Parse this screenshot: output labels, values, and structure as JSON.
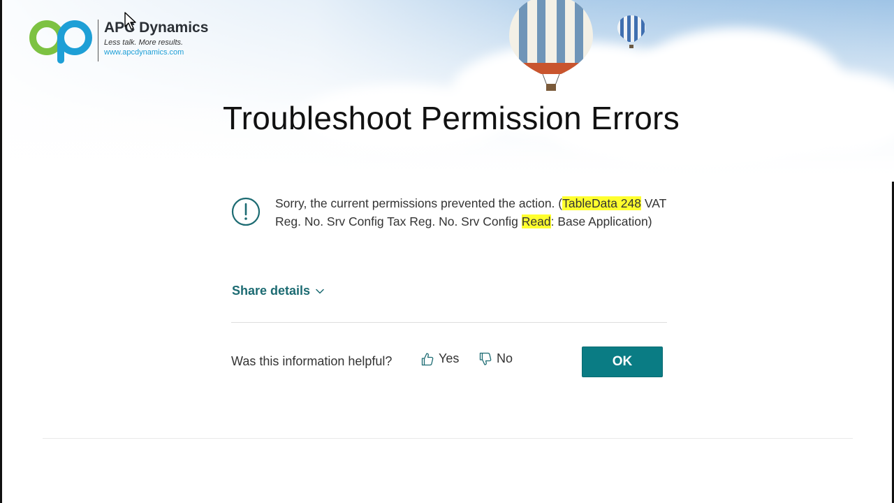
{
  "logo": {
    "brand": "APC Dynamics",
    "tagline": "Less talk. More results.",
    "url": "www.apcdynamics.com"
  },
  "slide": {
    "title": "Troubleshoot Permission Errors"
  },
  "dialog": {
    "message_parts": [
      {
        "text": "Sorry, the current permissions prevented the action. (",
        "highlight": false
      },
      {
        "text": "TableData 248",
        "highlight": true
      },
      {
        "text": " VAT Reg. No. Srv Config Tax Reg. No. Srv Config ",
        "highlight": false
      },
      {
        "text": "Read",
        "highlight": true
      },
      {
        "text": ": Base Application)",
        "highlight": false
      }
    ],
    "share_details_label": "Share details",
    "feedback_question": "Was this information helpful?",
    "yes_label": "Yes",
    "no_label": "No",
    "ok_label": "OK"
  },
  "colors": {
    "accent": "#0a7c84",
    "link": "#1c6b72",
    "highlight": "#ffff2e",
    "logo_green": "#7dc242",
    "logo_blue": "#1e9fd6"
  },
  "icons": {
    "info": "info-circle-icon",
    "share_chevron": "chevron-down-icon",
    "yes": "thumbs-up-icon",
    "no": "thumbs-down-icon"
  }
}
